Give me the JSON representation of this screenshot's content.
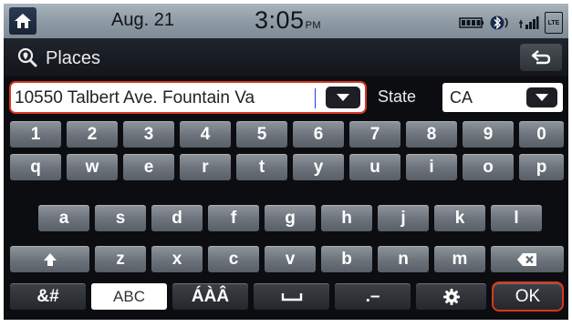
{
  "status": {
    "date": "Aug. 21",
    "time": "3:05",
    "ampm": "PM",
    "lte_label": "LTE",
    "icons": [
      "home-icon",
      "battery-icon",
      "bluetooth-phone-icon",
      "signal-icon",
      "lte-icon"
    ]
  },
  "title": {
    "text": "Places",
    "icons": [
      "places-search-icon",
      "back-arrow-icon"
    ]
  },
  "address": {
    "value": "10550 Talbert Ave. Fountain Va",
    "dropdown_icon": "chevron-down-icon"
  },
  "state": {
    "label": "State",
    "value": "CA",
    "dropdown_icon": "chevron-down-icon"
  },
  "keyboard": {
    "row1": [
      "1",
      "2",
      "3",
      "4",
      "5",
      "6",
      "7",
      "8",
      "9",
      "0"
    ],
    "row2": [
      "q",
      "w",
      "e",
      "r",
      "t",
      "y",
      "u",
      "i",
      "o",
      "p"
    ],
    "row3": [
      "a",
      "s",
      "d",
      "f",
      "g",
      "h",
      "j",
      "k",
      "l"
    ],
    "row4": [
      "z",
      "x",
      "c",
      "v",
      "b",
      "n",
      "m"
    ],
    "symbols_label": "&#",
    "abc_label": "ABC",
    "accents_label": "ÁÀÂ",
    "dash_label": ".–",
    "ok_label": "OK",
    "special_icons": [
      "shift-icon",
      "backspace-icon",
      "space-icon",
      "settings-icon"
    ]
  },
  "colors": {
    "highlight": "#d9361e",
    "background": "#0c0d11",
    "status_bar": "#8d99a3"
  }
}
